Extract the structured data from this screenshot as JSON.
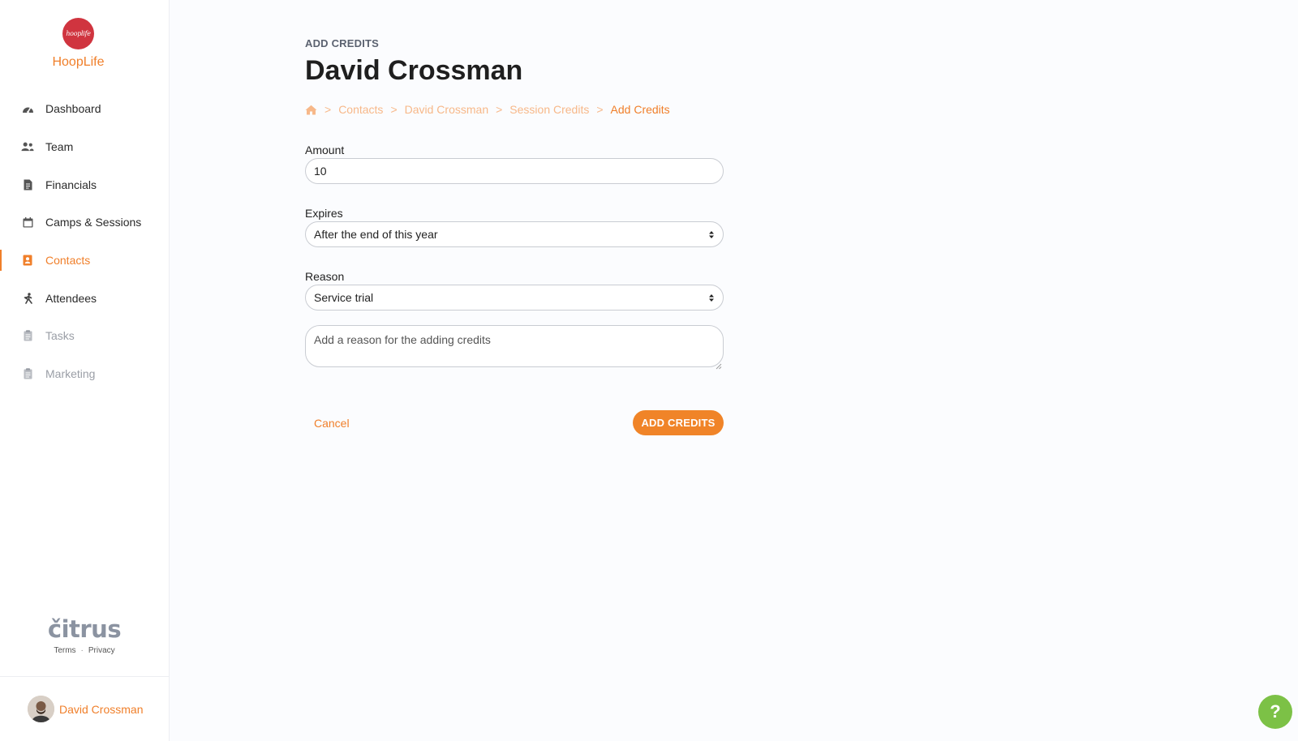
{
  "brand": {
    "logo_text": "hooplife",
    "name": "HoopLife"
  },
  "sidebar": {
    "items": [
      {
        "label": "Dashboard",
        "icon": "gauge-icon",
        "state": "normal"
      },
      {
        "label": "Team",
        "icon": "users-icon",
        "state": "normal"
      },
      {
        "label": "Financials",
        "icon": "receipt-icon",
        "state": "normal"
      },
      {
        "label": "Camps & Sessions",
        "icon": "calendar-icon",
        "state": "normal"
      },
      {
        "label": "Contacts",
        "icon": "address-book-icon",
        "state": "active"
      },
      {
        "label": "Attendees",
        "icon": "running-icon",
        "state": "normal"
      },
      {
        "label": "Tasks",
        "icon": "clipboard-icon",
        "state": "disabled"
      },
      {
        "label": "Marketing",
        "icon": "clipboard-icon",
        "state": "disabled"
      }
    ],
    "footer": {
      "logo": "čitrus",
      "terms": "Terms",
      "separator": "·",
      "privacy": "Privacy"
    },
    "user": {
      "name": "David Crossman"
    }
  },
  "page": {
    "eyebrow": "ADD CREDITS",
    "title": "David Crossman",
    "breadcrumb": [
      "Contacts",
      "David Crossman",
      "Session Credits",
      "Add Credits"
    ],
    "breadcrumb_separator": ">"
  },
  "form": {
    "amount_label": "Amount",
    "amount_value": "10",
    "expires_label": "Expires",
    "expires_value": "After the end of this year",
    "reason_label": "Reason",
    "reason_value": "Service trial",
    "reason_placeholder": "Add a reason for the adding credits",
    "cancel_label": "Cancel",
    "submit_label": "ADD CREDITS"
  },
  "help": {
    "label": "?"
  },
  "colors": {
    "accent": "#f07f2a",
    "accent_light": "#f7b889",
    "logo_red": "#d0343f",
    "help_green": "#7cc146"
  }
}
